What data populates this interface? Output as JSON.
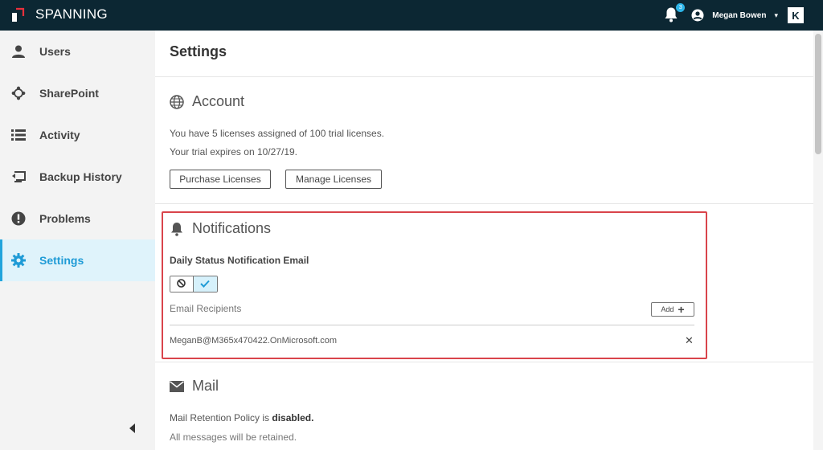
{
  "brand": {
    "name": "SPANNING",
    "accent": "#e8303c"
  },
  "topbar": {
    "notification_count": "3",
    "user_name": "Megan Bowen",
    "caret": "▾",
    "partner_logo": "K"
  },
  "sidebar": {
    "items": [
      {
        "label": "Users",
        "icon": "user-icon"
      },
      {
        "label": "SharePoint",
        "icon": "sharepoint-icon"
      },
      {
        "label": "Activity",
        "icon": "list-icon"
      },
      {
        "label": "Backup History",
        "icon": "restore-icon"
      },
      {
        "label": "Problems",
        "icon": "alert-icon"
      },
      {
        "label": "Settings",
        "icon": "gear-icon",
        "active": true
      }
    ],
    "collapse_icon": "chevron-left-icon"
  },
  "main": {
    "title": "Settings",
    "account": {
      "heading": "Account",
      "licenses_text": "You have 5 licenses assigned of 100 trial licenses.",
      "expiry_text": "Your trial expires on 10/27/19.",
      "purchase_label": "Purchase Licenses",
      "manage_label": "Manage Licenses"
    },
    "notifications": {
      "heading": "Notifications",
      "daily_label": "Daily Status Notification Email",
      "toggle_state": "on",
      "recipients_label": "Email Recipients",
      "add_label": "Add",
      "recipients": [
        "MeganB@M365x470422.OnMicrosoft.com"
      ]
    },
    "mail": {
      "heading": "Mail",
      "policy_prefix": "Mail Retention Policy is ",
      "policy_value": "disabled.",
      "retained_text": "All messages will be retained."
    }
  },
  "colors": {
    "topbar": "#0c2733",
    "active_nav": "#1f9bd6",
    "active_nav_bg": "#dff3fb",
    "highlight_border": "#d9444b"
  }
}
